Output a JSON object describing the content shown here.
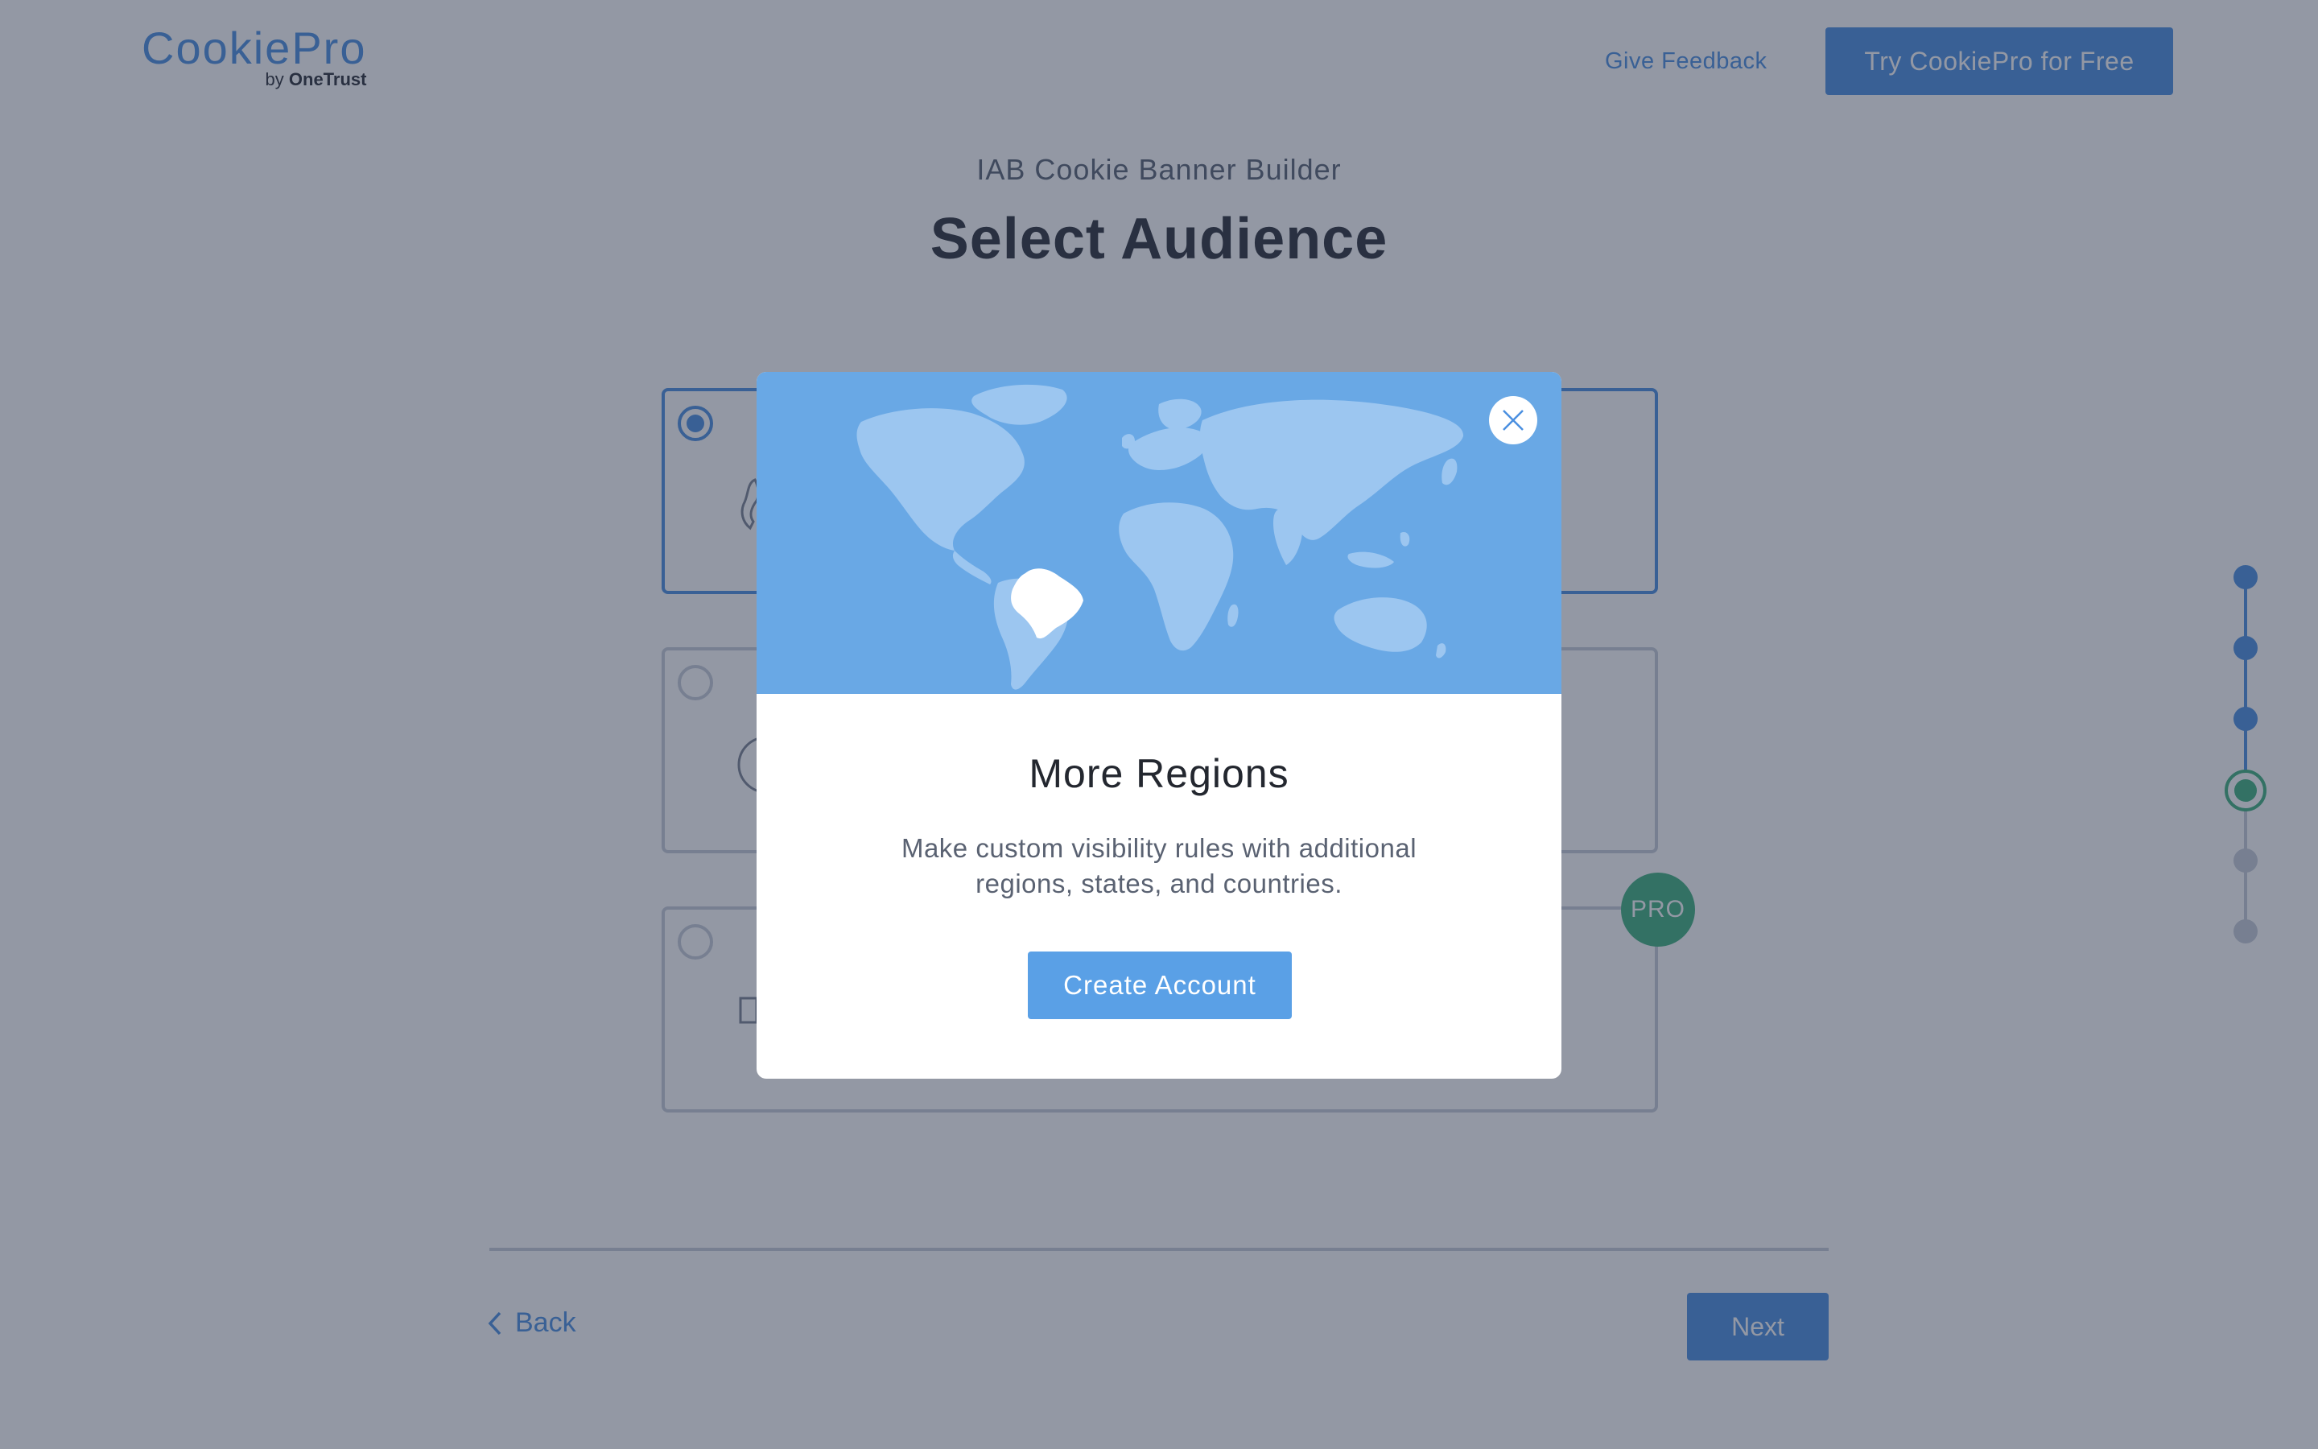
{
  "header": {
    "logo_main": "CookiePro",
    "logo_sub_prefix": "by ",
    "logo_sub_brand": "OneTrust",
    "feedback_label": "Give Feedback",
    "try_label": "Try CookiePro for Free"
  },
  "main": {
    "subtitle": "IAB Cookie Banner Builder",
    "title": "Select Audience",
    "options": [
      {
        "selected": true
      },
      {
        "selected": false
      },
      {
        "selected": false,
        "badge": "PRO"
      }
    ]
  },
  "footer": {
    "back_label": "Back",
    "next_label": "Next"
  },
  "stepper": {
    "total_steps": 6,
    "current_step": 4
  },
  "modal": {
    "title": "More Regions",
    "description_line1": "Make custom visibility rules with additional",
    "description_line2": "regions, states, and countries.",
    "button_label": "Create Account",
    "close_icon": "close-icon",
    "map_icon": "world-map-icon"
  },
  "colors": {
    "accent": "#4a8fe0",
    "pro_badge": "#3fb07e",
    "map_background": "#69a8e5",
    "map_land": "#9cc6f0",
    "highlight_country": "#ffffff"
  }
}
